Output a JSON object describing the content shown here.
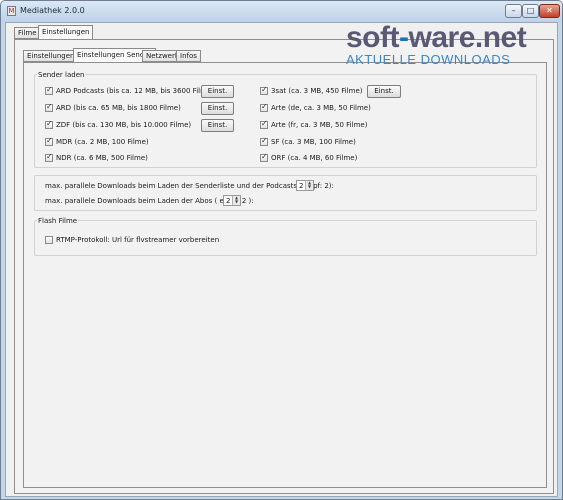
{
  "window": {
    "title": "Mediathek 2.0.0",
    "icon": "app-icon"
  },
  "window_controls": {
    "minimize": "–",
    "maximize": "□",
    "close": "✕"
  },
  "outer_tabs": [
    {
      "label": "Filme",
      "selected": false
    },
    {
      "label": "Einstellungen",
      "selected": true
    }
  ],
  "inner_tabs": [
    {
      "label": "Einstellungen",
      "selected": false
    },
    {
      "label": "Einstellungen Sender",
      "selected": true
    },
    {
      "label": "Netzwerk",
      "selected": false
    },
    {
      "label": "Infos",
      "selected": false
    }
  ],
  "sender_section": {
    "title": "Sender laden",
    "left_senders": [
      {
        "label": "ARD Podcasts  (bis ca. 12 MB, bis 3600 Filme)",
        "checked": true,
        "button": "Einst."
      },
      {
        "label": "ARD  (bis ca. 65 MB, bis 1800 Filme)",
        "checked": true,
        "button": "Einst."
      },
      {
        "label": "ZDF  (bis ca. 130 MB, bis 10.000 Filme)",
        "checked": true,
        "button": "Einst."
      },
      {
        "label": "MDR  (ca. 2 MB, 100 Filme)",
        "checked": true
      },
      {
        "label": "NDR  (ca. 6 MB, 500 Filme)",
        "checked": true
      }
    ],
    "right_senders": [
      {
        "label": "3sat  (ca. 3 MB, 450 Filme)",
        "checked": true,
        "button": "Einst."
      },
      {
        "label": "Arte (de, ca. 3 MB, 50 Filme)",
        "checked": true
      },
      {
        "label": "Arte  (fr, ca. 3 MB, 50 Filme)",
        "checked": true
      },
      {
        "label": "SF  (ca. 3 MB, 100 Filme)",
        "checked": true
      },
      {
        "label": "ORF (ca. 4 MB, 60 Filme)",
        "checked": true
      }
    ]
  },
  "downloads_section": {
    "parallel_sender_label": "max. parallele Downloads beim Laden der Senderliste und der Podcasts (empf: 2):",
    "parallel_sender_value": "2",
    "parallel_abos_label": "max. parallele Downloads beim Laden der Abos ( empf: 2 ):",
    "parallel_abos_value": "2"
  },
  "flash_section": {
    "title": "Flash Filme",
    "rtmp_label": "RTMP-Protokoll: Url für flvstreamer vorbereiten",
    "rtmp_checked": false
  },
  "watermark": {
    "brand": "soft",
    "brand_dash": "-",
    "brand_rest": "ware.net",
    "tagline": "AKTUELLE DOWNLOADS"
  }
}
